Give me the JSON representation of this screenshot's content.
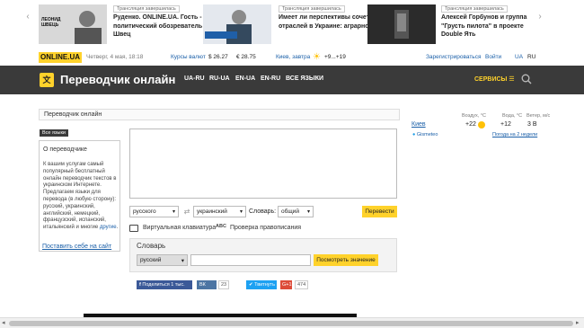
{
  "news": [
    {
      "tag": "Трансляция завершилась",
      "title": "Руденко. ONLINE.UA. Гость - политический обозреватель Леонид Швец",
      "thumb_label": "ЛЕОНИД ШВЕЦЬ"
    },
    {
      "tag": "Трансляция завершилась",
      "title": "Имеет ли перспективы сочетание трех отраслей в Украине: аграрной,...",
      "thumb_label": ""
    },
    {
      "tag": "Трансляция завершилась",
      "title": "Алексей Горбунов и группа \"Грусть пилота\" в проекте Double Ять",
      "thumb_label": ""
    }
  ],
  "topbar": {
    "logo": "ONLINE.UA",
    "date": "Четверг, 4 мая, 18:18",
    "rates_label": "Курсы валют",
    "usd": "$ 26.27",
    "eur": "€ 28.75",
    "weather_city": "Киев, завтра",
    "weather_temp": "+9...+19",
    "register": "Зарегистрироваться",
    "login": "Войти",
    "lang_ua": "UA",
    "lang_ru": "RU"
  },
  "header": {
    "title": "Переводчик онлайн",
    "langs": [
      "UA-RU",
      "RU-UA",
      "EN-UA",
      "EN-RU",
      "ВСЕ ЯЗЫКИ"
    ],
    "services": "СЕРВИСЫ"
  },
  "breadcrumb": "Переводчик онлайн",
  "all_langs_tag": "Все языки",
  "about": {
    "title": "О переводчике",
    "text": "К вашим услугам самый популярный бесплатный онлайн переводчик текстов в украинском Интернете. Предлагаем языки для перевода (в любую сторону): русский, украинский, английский, немецкий, французский, испанский, итальянский и многие",
    "more": "другие",
    "add_to_site": "Поставить себе на сайт"
  },
  "translator": {
    "source_text": "",
    "from_lang": "русского",
    "to_lang": "украинский",
    "dict_label": "Словарь:",
    "dict_value": "общий",
    "translate_button": "Перевести",
    "virtual_keyboard": "Виртуальная клавиатура",
    "spellcheck": "Проверка правописания"
  },
  "dictionary": {
    "title": "Словарь",
    "lang": "русский",
    "input_value": "",
    "button": "Посмотреть значение"
  },
  "share": {
    "fb": "Поделиться 1 тыс.",
    "vk": "ВК",
    "vk_count": "23",
    "tw": "Твитнуть",
    "gp": "G+1",
    "gp_count": "474"
  },
  "weather": {
    "col_air": "Воздух, °C",
    "col_water": "Вода, °C",
    "col_wind": "Ветер, м/с",
    "city": "Киев",
    "air": "+22",
    "water": "+12",
    "wind": "3 В",
    "source": "Gismeteo",
    "forecast": "Погода на 2 недели"
  },
  "colors": {
    "accent": "#ffd22b",
    "header_bg": "#3a3a3a",
    "link": "#1a5fa8"
  }
}
